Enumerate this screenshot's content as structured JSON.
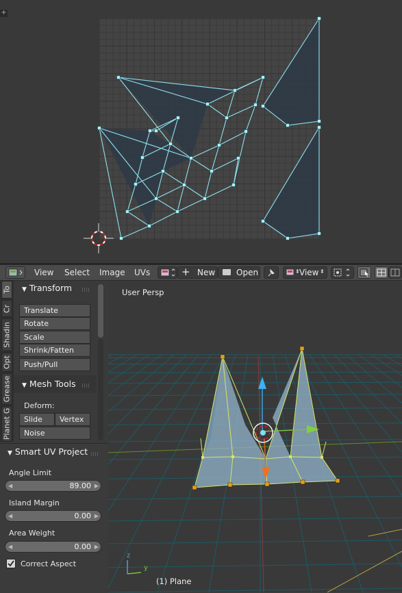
{
  "header": {
    "menus": [
      "View",
      "Select",
      "Image",
      "UVs"
    ],
    "new_label": "New",
    "open_label": "Open",
    "view_label": "View"
  },
  "tabs": [
    "To",
    "Cr",
    "Shadin",
    "Opt",
    "Grease",
    "Planet G"
  ],
  "transform_panel": {
    "title": "Transform",
    "buttons": [
      "Translate",
      "Rotate",
      "Scale",
      "Shrink/Fatten",
      "Push/Pull"
    ]
  },
  "mesh_tools_panel": {
    "title": "Mesh Tools",
    "deform_label": "Deform:",
    "slide_edge": "Slide Ed",
    "vertex": "Vertex",
    "noise": "Noise"
  },
  "smart_uv": {
    "title": "Smart UV Project",
    "angle_limit_label": "Angle Limit",
    "angle_limit_value": "89.00",
    "island_margin_label": "Island Margin",
    "island_margin_value": "0.00",
    "area_weight_label": "Area Weight",
    "area_weight_value": "0.00",
    "correct_aspect_label": "Correct Aspect",
    "correct_aspect_checked": true
  },
  "viewport": {
    "view_name": "User Persp",
    "object_label": "(1) Plane",
    "axis_z": "z",
    "axis_y": "y"
  },
  "colors": {
    "uv_line": "#8fe3f0",
    "uv_vertex": "#a8f0f8",
    "viewport_bg": "#393939",
    "grid_line": "#1c5b66",
    "edge_yellow": "#d8e46a",
    "vertex_orange": "#e8a010"
  },
  "icons": [
    "cursor-icon",
    "editor-type-icon",
    "image-browse-icon",
    "plus-icon",
    "folder-icon",
    "pin-icon",
    "view-mode-icon",
    "pivot-icon",
    "sticky-select-icon",
    "face-select-icon",
    "grip-icon",
    "checkbox-icon",
    "plus-corner-icon"
  ]
}
